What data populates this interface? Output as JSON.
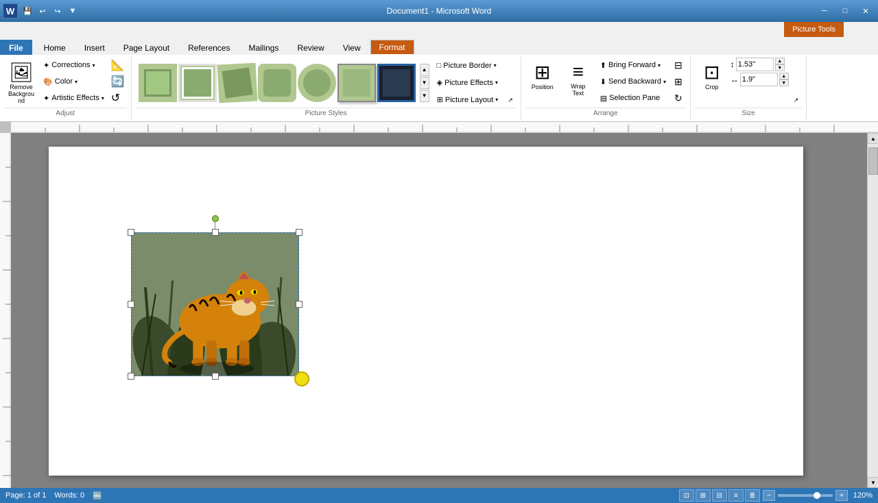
{
  "titlebar": {
    "app_name": "Document1 - Microsoft Word",
    "logo": "W",
    "minimize": "─",
    "maximize": "□",
    "close": "✕"
  },
  "picture_tools": {
    "label": "Picture Tools"
  },
  "tabs": [
    {
      "id": "file",
      "label": "File"
    },
    {
      "id": "home",
      "label": "Home"
    },
    {
      "id": "insert",
      "label": "Insert"
    },
    {
      "id": "page_layout",
      "label": "Page Layout"
    },
    {
      "id": "references",
      "label": "References"
    },
    {
      "id": "mailings",
      "label": "Mailings"
    },
    {
      "id": "review",
      "label": "Review"
    },
    {
      "id": "view",
      "label": "View"
    },
    {
      "id": "format",
      "label": "Format"
    }
  ],
  "ribbon": {
    "adjust_group": {
      "label": "Adjust",
      "remove_background": "Remove Background",
      "corrections": "Corrections",
      "color": "Color",
      "artistic_effects": "Artistic Effects"
    },
    "picture_styles_group": {
      "label": "Picture Styles"
    },
    "arrange_group": {
      "label": "Arrange",
      "position": "Position",
      "wrap_text": "Wrap Text",
      "bring_forward": "Bring Forward",
      "send_backward": "Send Backward",
      "selection_pane": "Selection Pane"
    },
    "size_group": {
      "label": "Size",
      "crop": "Crop",
      "height_label": "Height",
      "height_value": "1.53\"",
      "width_label": "Width",
      "width_value": "1.9\""
    }
  },
  "picture_buttons": {
    "picture_border": "Picture Border",
    "picture_effects": "Picture Effects",
    "picture_layout": "Picture Layout"
  },
  "status_bar": {
    "page": "Page: 1 of 1",
    "words": "Words: 0",
    "zoom": "120%"
  }
}
